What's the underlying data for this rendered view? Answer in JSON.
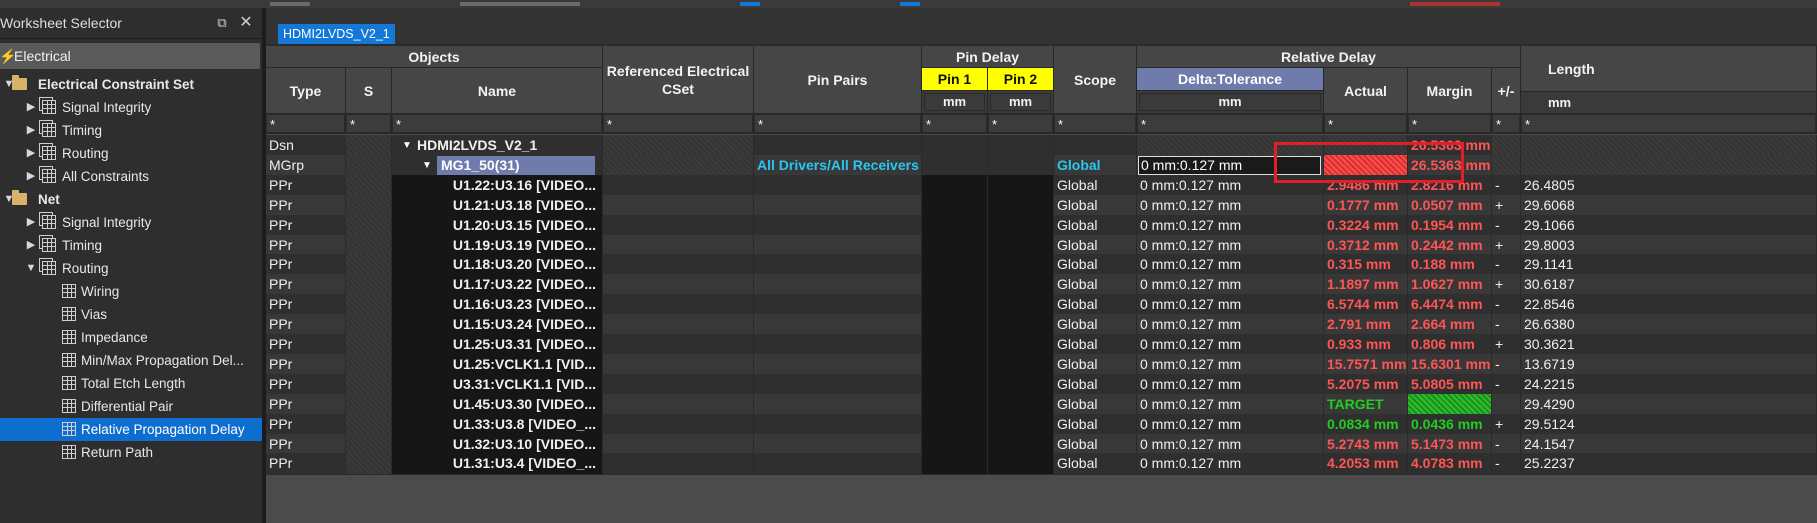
{
  "left_panel": {
    "title": "Worksheet Selector",
    "restore_icon": "⧉",
    "close_icon": "✕",
    "selector": "Electrical",
    "tree": [
      {
        "label": "Electrical Constraint Set",
        "bold": true
      },
      {
        "label": "Signal Integrity"
      },
      {
        "label": "Timing"
      },
      {
        "label": "Routing"
      },
      {
        "label": "All Constraints"
      },
      {
        "label": "Net",
        "bold": true
      },
      {
        "label": "Signal Integrity"
      },
      {
        "label": "Timing"
      },
      {
        "label": "Routing"
      },
      {
        "label": "Wiring"
      },
      {
        "label": "Vias"
      },
      {
        "label": "Impedance"
      },
      {
        "label": "Min/Max Propagation Del..."
      },
      {
        "label": "Total Etch Length"
      },
      {
        "label": "Differential Pair"
      },
      {
        "label": "Relative Propagation Delay",
        "selected": true
      },
      {
        "label": "Return Path"
      }
    ]
  },
  "tab": {
    "label": "HDMI2LVDS_V2_1"
  },
  "headers": {
    "objects": "Objects",
    "type": "Type",
    "s": "S",
    "name": "Name",
    "ref_cset": "Referenced Electrical CSet",
    "pin_pairs": "Pin Pairs",
    "pin_delay": "Pin Delay",
    "pin1": "Pin 1",
    "pin2": "Pin 2",
    "pin1_unit": "mm",
    "pin2_unit": "mm",
    "scope": "Scope",
    "relative_delay": "Relative Delay",
    "delta_tolerance": "Delta:Tolerance",
    "delta_unit": "mm",
    "actual": "Actual",
    "margin": "Margin",
    "plusminus": "+/-",
    "length": "Length",
    "length_unit": "mm",
    "filter": "*"
  },
  "rows": [
    {
      "type": "Dsn",
      "name": "HDMI2LVDS_V2_1",
      "pin_pairs": "",
      "scope": "",
      "delta": "",
      "actual": "",
      "margin": "26.5363 mm",
      "pm": "",
      "length": ""
    },
    {
      "type": "MGrp",
      "name": "MG1_50(31)",
      "pin_pairs": "All Drivers/All Receivers",
      "scope": "Global",
      "delta": "0 mm:0.127 mm",
      "actual": "",
      "margin": "26.5363 mm",
      "pm": "",
      "length": ""
    },
    {
      "type": "PPr",
      "name": "U1.22:U3.16 [VIDEO...",
      "scope": "Global",
      "delta": "0 mm:0.127 mm",
      "actual": "2.9486 mm",
      "margin": "2.8216 mm",
      "pm": "-",
      "length": "26.4805"
    },
    {
      "type": "PPr",
      "name": "U1.21:U3.18 [VIDEO...",
      "scope": "Global",
      "delta": "0 mm:0.127 mm",
      "actual": "0.1777 mm",
      "margin": "0.0507 mm",
      "pm": "+",
      "length": "29.6068"
    },
    {
      "type": "PPr",
      "name": "U1.20:U3.15 [VIDEO...",
      "scope": "Global",
      "delta": "0 mm:0.127 mm",
      "actual": "0.3224 mm",
      "margin": "0.1954 mm",
      "pm": "-",
      "length": "29.1066"
    },
    {
      "type": "PPr",
      "name": "U1.19:U3.19 [VIDEO...",
      "scope": "Global",
      "delta": "0 mm:0.127 mm",
      "actual": "0.3712 mm",
      "margin": "0.2442 mm",
      "pm": "+",
      "length": "29.8003"
    },
    {
      "type": "PPr",
      "name": "U1.18:U3.20 [VIDEO...",
      "scope": "Global",
      "delta": "0 mm:0.127 mm",
      "actual": "0.315 mm",
      "margin": "0.188 mm",
      "pm": "-",
      "length": "29.1141"
    },
    {
      "type": "PPr",
      "name": "U1.17:U3.22 [VIDEO...",
      "scope": "Global",
      "delta": "0 mm:0.127 mm",
      "actual": "1.1897 mm",
      "margin": "1.0627 mm",
      "pm": "+",
      "length": "30.6187"
    },
    {
      "type": "PPr",
      "name": "U1.16:U3.23 [VIDEO...",
      "scope": "Global",
      "delta": "0 mm:0.127 mm",
      "actual": "6.5744 mm",
      "margin": "6.4474 mm",
      "pm": "-",
      "length": "22.8546"
    },
    {
      "type": "PPr",
      "name": "U1.15:U3.24 [VIDEO...",
      "scope": "Global",
      "delta": "0 mm:0.127 mm",
      "actual": "2.791 mm",
      "margin": "2.664 mm",
      "pm": "-",
      "length": "26.6380"
    },
    {
      "type": "PPr",
      "name": "U1.25:U3.31 [VIDEO...",
      "scope": "Global",
      "delta": "0 mm:0.127 mm",
      "actual": "0.933 mm",
      "margin": "0.806 mm",
      "pm": "+",
      "length": "30.3621"
    },
    {
      "type": "PPr",
      "name": "U1.25:VCLK1.1 [VID...",
      "scope": "Global",
      "delta": "0 mm:0.127 mm",
      "actual": "15.7571 mm",
      "margin": "15.6301 mm",
      "pm": "-",
      "length": "13.6719"
    },
    {
      "type": "PPr",
      "name": "U3.31:VCLK1.1 [VID...",
      "scope": "Global",
      "delta": "0 mm:0.127 mm",
      "actual": "5.2075 mm",
      "margin": "5.0805 mm",
      "pm": "-",
      "length": "24.2215"
    },
    {
      "type": "PPr",
      "name": "U1.45:U3.30 [VIDEO...",
      "scope": "Global",
      "delta": "0 mm:0.127 mm",
      "actual": "TARGET",
      "margin": "",
      "pm": "",
      "length": "29.4290"
    },
    {
      "type": "PPr",
      "name": "U1.33:U3.8 [VIDEO_...",
      "scope": "Global",
      "delta": "0 mm:0.127 mm",
      "actual": "0.0834 mm",
      "margin": "0.0436 mm",
      "pm": "+",
      "length": "29.5124"
    },
    {
      "type": "PPr",
      "name": "U1.32:U3.10 [VIDEO...",
      "scope": "Global",
      "delta": "0 mm:0.127 mm",
      "actual": "5.2743 mm",
      "margin": "5.1473 mm",
      "pm": "-",
      "length": "24.1547"
    },
    {
      "type": "PPr",
      "name": "U1.31:U3.4 [VIDEO_...",
      "scope": "Global",
      "delta": "0 mm:0.127 mm",
      "actual": "4.2053 mm",
      "margin": "4.0783 mm",
      "pm": "-",
      "length": "25.2237"
    }
  ],
  "colors": {
    "fail_red": "#ff5555",
    "pass_green": "#22cc22",
    "link_cyan": "#29c6f0",
    "selection_blue": "#0d6ecf",
    "header_yellow": "#ffff00",
    "callout_red": "#e01f2a"
  }
}
